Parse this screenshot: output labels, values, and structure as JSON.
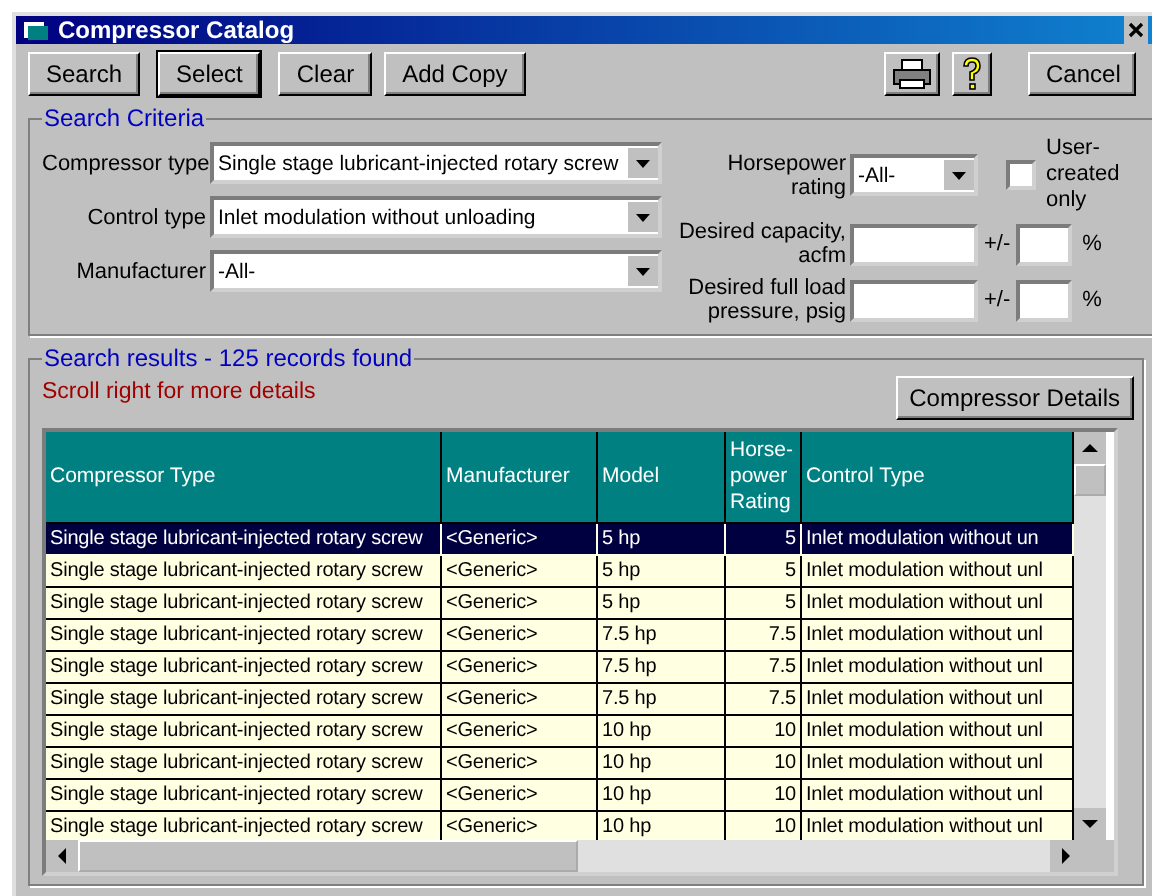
{
  "window": {
    "title": "Compressor Catalog"
  },
  "toolbar": {
    "buttons": [
      {
        "label": "Search",
        "default": false
      },
      {
        "label": "Select",
        "default": true
      },
      {
        "label": "Clear",
        "default": false
      },
      {
        "label": "Add Copy",
        "default": false
      }
    ],
    "cancel": "Cancel"
  },
  "search_criteria": {
    "title": "Search Criteria",
    "combos": [
      {
        "label": "Compressor type",
        "value": "Single stage lubricant-injected rotary screw"
      },
      {
        "label": "Control type",
        "value": "Inlet modulation without unloading"
      },
      {
        "label": "Manufacturer",
        "value": "-All-"
      }
    ],
    "horsepower": {
      "label": "Horsepower rating",
      "value": "-All-"
    },
    "user_created_only": {
      "label": "User-created only",
      "checked": false
    },
    "ranges": [
      {
        "label": "Desired capacity, acfm",
        "tolerance": "+/-",
        "unit": "%"
      },
      {
        "label": "Desired full load pressure, psig",
        "tolerance": "+/-",
        "unit": "%"
      }
    ]
  },
  "results": {
    "title": "Search results - 125 records found",
    "hint": "Scroll right for more details",
    "details_button": "Compressor Details",
    "table": {
      "columns": [
        "Compressor Type",
        "Manufacturer",
        "Model",
        "Horse-power Rating",
        "Control Type"
      ],
      "rows": [
        {
          "cells": [
            "Single stage lubricant-injected rotary screw",
            "<Generic>",
            "5 hp",
            "5",
            "Inlet modulation without un"
          ],
          "selected": true
        },
        {
          "cells": [
            "Single stage lubricant-injected rotary screw",
            "<Generic>",
            "5 hp",
            "5",
            "Inlet modulation without unl"
          ],
          "selected": false
        },
        {
          "cells": [
            "Single stage lubricant-injected rotary screw",
            "<Generic>",
            "5 hp",
            "5",
            "Inlet modulation without unl"
          ],
          "selected": false
        },
        {
          "cells": [
            "Single stage lubricant-injected rotary screw",
            "<Generic>",
            "7.5 hp",
            "7.5",
            "Inlet modulation without unl"
          ],
          "selected": false
        },
        {
          "cells": [
            "Single stage lubricant-injected rotary screw",
            "<Generic>",
            "7.5 hp",
            "7.5",
            "Inlet modulation without unl"
          ],
          "selected": false
        },
        {
          "cells": [
            "Single stage lubricant-injected rotary screw",
            "<Generic>",
            "7.5 hp",
            "7.5",
            "Inlet modulation without unl"
          ],
          "selected": false
        },
        {
          "cells": [
            "Single stage lubricant-injected rotary screw",
            "<Generic>",
            "10 hp",
            "10",
            "Inlet modulation without unl"
          ],
          "selected": false
        },
        {
          "cells": [
            "Single stage lubricant-injected rotary screw",
            "<Generic>",
            "10 hp",
            "10",
            "Inlet modulation without unl"
          ],
          "selected": false
        },
        {
          "cells": [
            "Single stage lubricant-injected rotary screw",
            "<Generic>",
            "10 hp",
            "10",
            "Inlet modulation without unl"
          ],
          "selected": false
        },
        {
          "cells": [
            "Single stage lubricant-injected rotary screw",
            "<Generic>",
            "10 hp",
            "10",
            "Inlet modulation without unl"
          ],
          "selected": false
        }
      ]
    }
  }
}
